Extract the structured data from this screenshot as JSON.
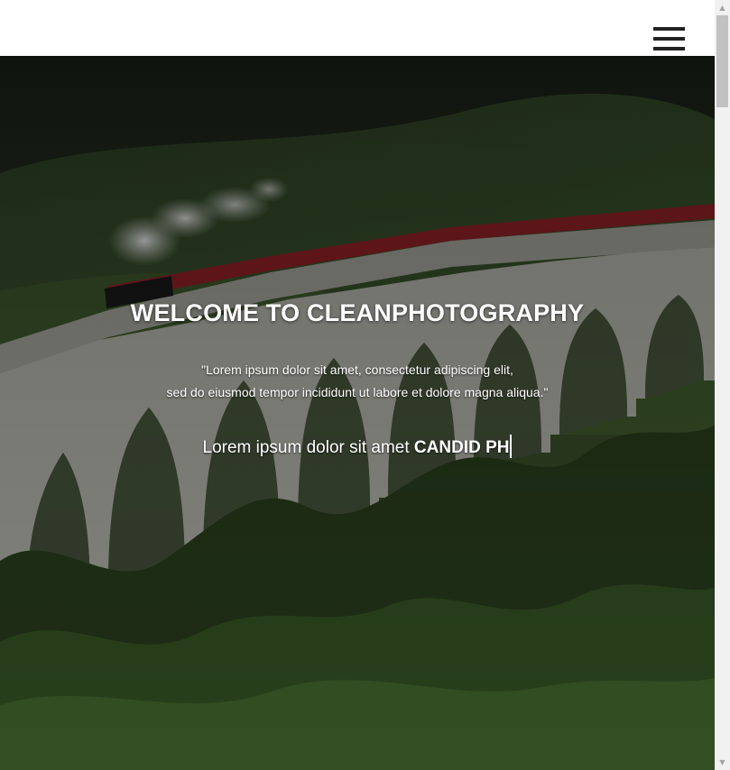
{
  "header": {
    "menu_icon": "hamburger-menu-icon"
  },
  "hero": {
    "title": "WELCOME TO CLEANPHOTOGRAPHY",
    "quote_line1": "\"Lorem ipsum dolor sit amet, consectetur adipiscing elit,",
    "quote_line2": "sed do eiusmod tempor incididunt ut labore et dolore magna aliqua.\"",
    "typed_prefix": "Lorem ipsum dolor sit amet ",
    "typed_text": "CANDID PH",
    "background_description_icon": "train-viaduct-photo",
    "overlay_color": "#000000"
  },
  "scrollbar": {
    "up_icon": "scroll-up-arrow-icon",
    "down_icon": "scroll-down-arrow-icon",
    "up_glyph": "▲",
    "down_glyph": "▼"
  }
}
